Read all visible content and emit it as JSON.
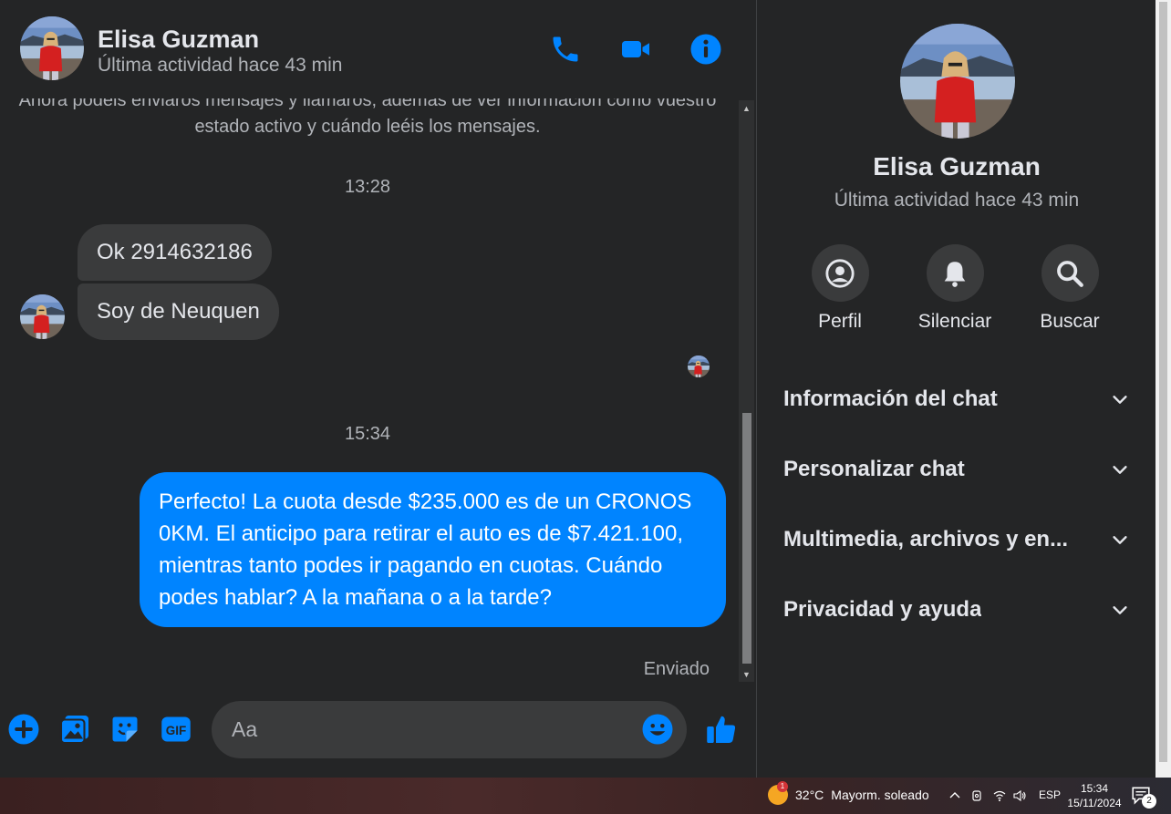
{
  "colors": {
    "accent": "#0084ff",
    "background": "#242526",
    "bubble_in": "#3a3b3c",
    "secondary_text": "#b0b3b8"
  },
  "header": {
    "name": "Elisa Guzman",
    "status": "Última actividad hace 43 min",
    "icons": [
      "phone-icon",
      "video-camera-icon",
      "info-icon"
    ]
  },
  "conversation": {
    "notice": "Ahora podéis enviaros mensajes y llamaros, además de ver información como vuestro estado activo y cuándo leéis los mensajes.",
    "time1": "13:28",
    "incoming": [
      "Ok 2914632186",
      "Soy de Neuquen"
    ],
    "time2": "15:34",
    "outgoing": "Perfecto! La cuota desde $235.000 es de un CRONOS 0KM. El anticipo para retirar el auto es de $7.421.100, mientras tanto podes ir pagando en cuotas. Cuándo podes hablar? A la mañana o a la tarde?",
    "sent_status": "Enviado"
  },
  "composer": {
    "placeholder": "Aa",
    "icons": [
      "plus-icon",
      "photo-icon",
      "sticker-icon",
      "gif-icon",
      "emoji-icon",
      "like-icon"
    ],
    "gif_label": "GIF"
  },
  "sidebar": {
    "name": "Elisa Guzman",
    "status": "Última actividad hace 43 min",
    "actions": [
      {
        "label": "Perfil",
        "icon": "profile-icon"
      },
      {
        "label": "Silenciar",
        "icon": "bell-icon"
      },
      {
        "label": "Buscar",
        "icon": "search-icon"
      }
    ],
    "sections": [
      {
        "label": "Información del chat"
      },
      {
        "label": "Personalizar chat"
      },
      {
        "label": "Multimedia, archivos y en..."
      },
      {
        "label": "Privacidad y ayuda"
      }
    ]
  },
  "taskbar": {
    "weather_badge": "1",
    "temperature": "32°C",
    "weather": "Mayorm. soleado",
    "language": "ESP",
    "time": "15:34",
    "date": "15/11/2024",
    "notifications": "2"
  }
}
